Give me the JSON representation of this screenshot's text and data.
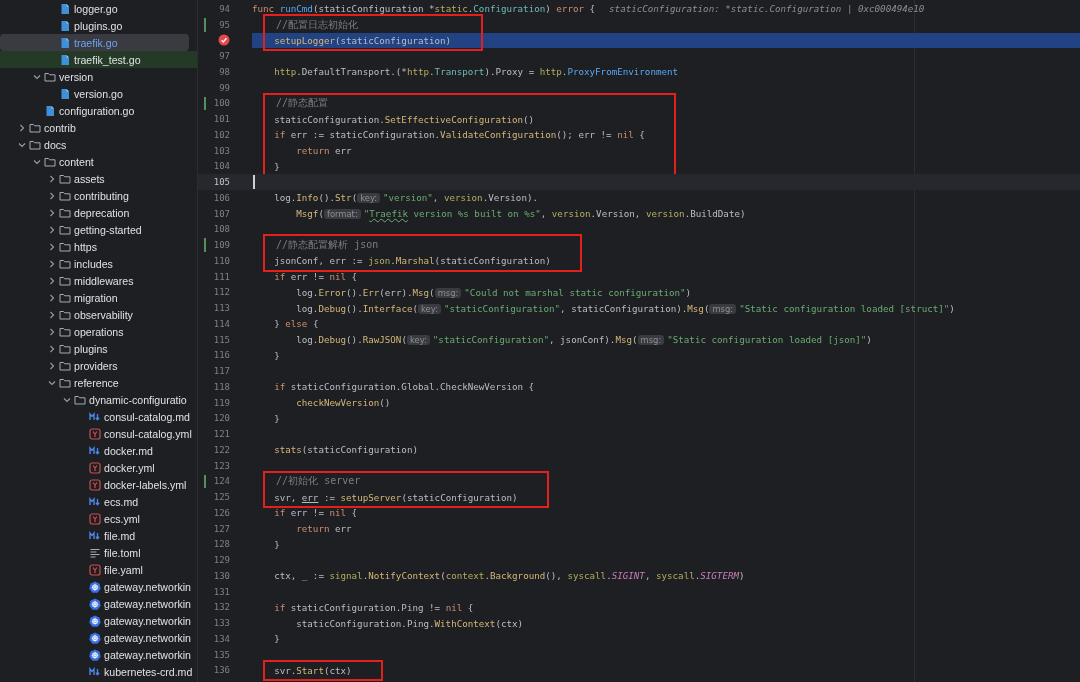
{
  "tree": [
    {
      "children": [
        {
          "children": [
            {
              "label": "logger.go",
              "kind": "go",
              "selected": false
            },
            {
              "label": "plugins.go",
              "kind": "go",
              "selected": false
            },
            {
              "label": "traefik.go",
              "kind": "go",
              "selected": true
            },
            {
              "label": "traefik_test.go",
              "kind": "go",
              "selected": false,
              "added": true
            }
          ]
        },
        {
          "label": "version",
          "kind": "folder",
          "expanded": true,
          "selected": false,
          "children": [
            {
              "label": "version.go",
              "kind": "go",
              "selected": false
            }
          ]
        },
        {
          "label": "configuration.go",
          "kind": "go",
          "selected": false
        }
      ]
    },
    {
      "label": "contrib",
      "kind": "folder",
      "expanded": false,
      "selected": false
    },
    {
      "label": "docs",
      "kind": "folder",
      "expanded": true,
      "selected": false,
      "children": [
        {
          "label": "content",
          "kind": "folder",
          "expanded": true,
          "selected": false,
          "children": [
            {
              "label": "assets",
              "kind": "folder",
              "expanded": false,
              "selected": false
            },
            {
              "label": "contributing",
              "kind": "folder",
              "expanded": false,
              "selected": false
            },
            {
              "label": "deprecation",
              "kind": "folder",
              "expanded": false,
              "selected": false
            },
            {
              "label": "getting-started",
              "kind": "folder",
              "expanded": false,
              "selected": false
            },
            {
              "label": "https",
              "kind": "folder",
              "expanded": false,
              "selected": false
            },
            {
              "label": "includes",
              "kind": "folder",
              "expanded": false,
              "selected": false
            },
            {
              "label": "middlewares",
              "kind": "folder",
              "expanded": false,
              "selected": false
            },
            {
              "label": "migration",
              "kind": "folder",
              "expanded": false,
              "selected": false
            },
            {
              "label": "observability",
              "kind": "folder",
              "expanded": false,
              "selected": false
            },
            {
              "label": "operations",
              "kind": "folder",
              "expanded": false,
              "selected": false
            },
            {
              "label": "plugins",
              "kind": "folder",
              "expanded": false,
              "selected": false
            },
            {
              "label": "providers",
              "kind": "folder",
              "expanded": false,
              "selected": false
            },
            {
              "label": "reference",
              "kind": "folder",
              "expanded": true,
              "selected": false,
              "children": [
                {
                  "label": "dynamic-configuratio",
                  "kind": "folder",
                  "expanded": true,
                  "selected": false,
                  "children": [
                    {
                      "label": "consul-catalog.md",
                      "kind": "md",
                      "selected": false
                    },
                    {
                      "label": "consul-catalog.yml",
                      "kind": "yml",
                      "selected": false
                    },
                    {
                      "label": "docker.md",
                      "kind": "md",
                      "selected": false
                    },
                    {
                      "label": "docker.yml",
                      "kind": "yml",
                      "selected": false
                    },
                    {
                      "label": "docker-labels.yml",
                      "kind": "yml",
                      "selected": false
                    },
                    {
                      "label": "ecs.md",
                      "kind": "md",
                      "selected": false
                    },
                    {
                      "label": "ecs.yml",
                      "kind": "yml",
                      "selected": false
                    },
                    {
                      "label": "file.md",
                      "kind": "md",
                      "selected": false
                    },
                    {
                      "label": "file.toml",
                      "kind": "toml",
                      "selected": false
                    },
                    {
                      "label": "file.yaml",
                      "kind": "yml",
                      "selected": false
                    },
                    {
                      "label": "gateway.networkin",
                      "kind": "k8s",
                      "selected": false
                    },
                    {
                      "label": "gateway.networkin",
                      "kind": "k8s",
                      "selected": false
                    },
                    {
                      "label": "gateway.networkin",
                      "kind": "k8s",
                      "selected": false
                    },
                    {
                      "label": "gateway.networkin",
                      "kind": "k8s",
                      "selected": false
                    },
                    {
                      "label": "gateway.networkin",
                      "kind": "k8s",
                      "selected": false
                    },
                    {
                      "label": "kubernetes-crd.md",
                      "kind": "md",
                      "selected": false
                    }
                  ]
                }
              ]
            }
          ]
        }
      ]
    }
  ],
  "code": {
    "blocks": [
      {
        "annotated": false,
        "lines": [
          {
            "number": "94",
            "tokens": [
              {
                "kind": "kw",
                "text": "func "
              },
              {
                "kind": "fn",
                "text": "runCmd"
              },
              {
                "kind": "plain",
                "text": "(staticConfiguration *"
              },
              {
                "kind": "pkg",
                "text": "static"
              },
              {
                "kind": "plain",
                "text": "."
              },
              {
                "kind": "type",
                "text": "Configuration"
              },
              {
                "kind": "plain",
                "text": ") "
              },
              {
                "kind": "kw",
                "text": "error"
              },
              {
                "kind": "plain",
                "text": " {"
              }
            ],
            "inline_value": "staticConfiguration: *static.Configuration | 0xc000494e10"
          }
        ]
      },
      {
        "annotated": true,
        "lines": [
          {
            "number": "95",
            "modified": true,
            "tokens": [
              {
                "kind": "comment",
                "text": "    //配置日志初始化"
              }
            ]
          },
          {
            "breakpoint": true,
            "execution": true,
            "tokens": [
              {
                "kind": "call",
                "text": "    setupLogger"
              },
              {
                "kind": "plain",
                "text": "(staticConfiguration)"
              }
            ]
          }
        ]
      },
      {
        "annotated": false,
        "lines": [
          {
            "number": "97"
          },
          {
            "number": "98",
            "tokens": [
              {
                "kind": "pkg",
                "text": "    http"
              },
              {
                "kind": "plain",
                "text": ".DefaultTransport.(*"
              },
              {
                "kind": "pkg",
                "text": "http"
              },
              {
                "kind": "plain",
                "text": "."
              },
              {
                "kind": "type",
                "text": "Transport"
              },
              {
                "kind": "plain",
                "text": ").Proxy = "
              },
              {
                "kind": "pkg",
                "text": "http"
              },
              {
                "kind": "plain",
                "text": "."
              },
              {
                "kind": "ref",
                "text": "ProxyFromEnvironment"
              }
            ]
          },
          {
            "number": "99"
          }
        ]
      },
      {
        "annotated": true,
        "lines": [
          {
            "number": "100",
            "modified": true,
            "tokens": [
              {
                "kind": "comment",
                "text": "    //静态配置"
              }
            ]
          },
          {
            "number": "101",
            "tokens": [
              {
                "kind": "plain",
                "text": "    staticConfiguration."
              },
              {
                "kind": "call",
                "text": "SetEffectiveConfiguration"
              },
              {
                "kind": "plain",
                "text": "()"
              }
            ]
          },
          {
            "number": "102",
            "tokens": [
              {
                "kind": "kw",
                "text": "    if "
              },
              {
                "kind": "plain",
                "text": "err := staticConfiguration."
              },
              {
                "kind": "call",
                "text": "ValidateConfiguration"
              },
              {
                "kind": "plain",
                "text": "(); err != "
              },
              {
                "kind": "kw",
                "text": "nil"
              },
              {
                "kind": "plain",
                "text": " {"
              }
            ]
          },
          {
            "number": "103",
            "tokens": [
              {
                "kind": "kw",
                "text": "        return "
              },
              {
                "kind": "plain",
                "text": "err"
              }
            ]
          },
          {
            "number": "104",
            "tokens": [
              {
                "kind": "plain",
                "text": "    }"
              }
            ]
          }
        ]
      },
      {
        "annotated": false,
        "lines": [
          {
            "number": "105",
            "caret": true
          },
          {
            "number": "106",
            "tokens": [
              {
                "kind": "plain",
                "text": "    log."
              },
              {
                "kind": "call",
                "text": "Info"
              },
              {
                "kind": "plain",
                "text": "()."
              },
              {
                "kind": "call",
                "text": "Str"
              },
              {
                "kind": "plain",
                "text": "("
              },
              {
                "kind": "hint",
                "text": "key:"
              },
              {
                "kind": "str",
                "text": "\"version\""
              },
              {
                "kind": "plain",
                "text": ", "
              },
              {
                "kind": "pkg",
                "text": "version"
              },
              {
                "kind": "plain",
                "text": ".Version)."
              }
            ]
          },
          {
            "number": "107",
            "tokens": [
              {
                "kind": "call",
                "text": "        Msgf"
              },
              {
                "kind": "plain",
                "text": "("
              },
              {
                "kind": "hint",
                "text": "format:"
              },
              {
                "kind": "str",
                "text": "\""
              },
              {
                "kind": "typo",
                "text": "Traefik"
              },
              {
                "kind": "str",
                "text": " version %s built on %s\""
              },
              {
                "kind": "plain",
                "text": ", "
              },
              {
                "kind": "pkg",
                "text": "version"
              },
              {
                "kind": "plain",
                "text": ".Version, "
              },
              {
                "kind": "pkg",
                "text": "version"
              },
              {
                "kind": "plain",
                "text": ".BuildDate)"
              }
            ]
          },
          {
            "number": "108"
          }
        ]
      },
      {
        "annotated": true,
        "lines": [
          {
            "number": "109",
            "modified": true,
            "tokens": [
              {
                "kind": "comment",
                "text": "    //静态配置解析 json"
              }
            ]
          },
          {
            "number": "110",
            "tokens": [
              {
                "kind": "plain",
                "text": "    jsonConf, err := "
              },
              {
                "kind": "pkg",
                "text": "json"
              },
              {
                "kind": "plain",
                "text": "."
              },
              {
                "kind": "call",
                "text": "Marshal"
              },
              {
                "kind": "plain",
                "text": "(staticConfiguration)"
              }
            ]
          }
        ]
      },
      {
        "annotated": false,
        "lines": [
          {
            "number": "111",
            "tokens": [
              {
                "kind": "kw",
                "text": "    if "
              },
              {
                "kind": "plain",
                "text": "err != "
              },
              {
                "kind": "kw",
                "text": "nil"
              },
              {
                "kind": "plain",
                "text": " {"
              }
            ]
          },
          {
            "number": "112",
            "tokens": [
              {
                "kind": "plain",
                "text": "        log."
              },
              {
                "kind": "call",
                "text": "Error"
              },
              {
                "kind": "plain",
                "text": "()."
              },
              {
                "kind": "call",
                "text": "Err"
              },
              {
                "kind": "plain",
                "text": "(err)."
              },
              {
                "kind": "call",
                "text": "Msg"
              },
              {
                "kind": "plain",
                "text": "("
              },
              {
                "kind": "hint",
                "text": "msg:"
              },
              {
                "kind": "str",
                "text": "\"Could not marshal static configuration\""
              },
              {
                "kind": "plain",
                "text": ")"
              }
            ]
          },
          {
            "number": "113",
            "tokens": [
              {
                "kind": "plain",
                "text": "        log."
              },
              {
                "kind": "call",
                "text": "Debug"
              },
              {
                "kind": "plain",
                "text": "()."
              },
              {
                "kind": "call",
                "text": "Interface"
              },
              {
                "kind": "plain",
                "text": "("
              },
              {
                "kind": "hint",
                "text": "key:"
              },
              {
                "kind": "str",
                "text": "\"staticConfiguration\""
              },
              {
                "kind": "plain",
                "text": ", staticConfiguration)."
              },
              {
                "kind": "call",
                "text": "Msg"
              },
              {
                "kind": "plain",
                "text": "("
              },
              {
                "kind": "hint",
                "text": "msg:"
              },
              {
                "kind": "str",
                "text": "\"Static configuration loaded [struct]\""
              },
              {
                "kind": "plain",
                "text": ")"
              }
            ]
          },
          {
            "number": "114",
            "tokens": [
              {
                "kind": "plain",
                "text": "    } "
              },
              {
                "kind": "kw",
                "text": "else"
              },
              {
                "kind": "plain",
                "text": " {"
              }
            ]
          },
          {
            "number": "115",
            "tokens": [
              {
                "kind": "plain",
                "text": "        log."
              },
              {
                "kind": "call",
                "text": "Debug"
              },
              {
                "kind": "plain",
                "text": "()."
              },
              {
                "kind": "call",
                "text": "RawJSON"
              },
              {
                "kind": "plain",
                "text": "("
              },
              {
                "kind": "hint",
                "text": "key:"
              },
              {
                "kind": "str",
                "text": "\"staticConfiguration\""
              },
              {
                "kind": "plain",
                "text": ", jsonConf)."
              },
              {
                "kind": "call",
                "text": "Msg"
              },
              {
                "kind": "plain",
                "text": "("
              },
              {
                "kind": "hint",
                "text": "msg:"
              },
              {
                "kind": "str",
                "text": "\"Static configuration loaded [json]\""
              },
              {
                "kind": "plain",
                "text": ")"
              }
            ]
          },
          {
            "number": "116",
            "tokens": [
              {
                "kind": "plain",
                "text": "    }"
              }
            ]
          },
          {
            "number": "117"
          },
          {
            "number": "118",
            "tokens": [
              {
                "kind": "kw",
                "text": "    if "
              },
              {
                "kind": "plain",
                "text": "staticConfiguration.Global.CheckNewVersion {"
              }
            ]
          },
          {
            "number": "119",
            "tokens": [
              {
                "kind": "call",
                "text": "        checkNewVersion"
              },
              {
                "kind": "plain",
                "text": "()"
              }
            ]
          },
          {
            "number": "120",
            "tokens": [
              {
                "kind": "plain",
                "text": "    }"
              }
            ]
          },
          {
            "number": "121"
          },
          {
            "number": "122",
            "tokens": [
              {
                "kind": "call",
                "text": "    stats"
              },
              {
                "kind": "plain",
                "text": "(staticConfiguration)"
              }
            ]
          },
          {
            "number": "123"
          }
        ]
      },
      {
        "annotated": true,
        "lines": [
          {
            "number": "124",
            "modified": true,
            "tokens": [
              {
                "kind": "comment",
                "text": "    //初始化 server"
              }
            ]
          },
          {
            "number": "125",
            "tokens": [
              {
                "kind": "plain",
                "text": "    svr, "
              },
              {
                "kind": "under",
                "text": "err"
              },
              {
                "kind": "plain",
                "text": " := "
              },
              {
                "kind": "call",
                "text": "setupServer"
              },
              {
                "kind": "plain",
                "text": "(staticConfiguration)"
              }
            ]
          }
        ]
      },
      {
        "annotated": false,
        "lines": [
          {
            "number": "126",
            "tokens": [
              {
                "kind": "kw",
                "text": "    if "
              },
              {
                "kind": "plain",
                "text": "err != "
              },
              {
                "kind": "kw",
                "text": "nil"
              },
              {
                "kind": "plain",
                "text": " {"
              }
            ]
          },
          {
            "number": "127",
            "tokens": [
              {
                "kind": "kw",
                "text": "        return "
              },
              {
                "kind": "plain",
                "text": "err"
              }
            ]
          },
          {
            "number": "128",
            "tokens": [
              {
                "kind": "plain",
                "text": "    }"
              }
            ]
          },
          {
            "number": "129"
          },
          {
            "number": "130",
            "tokens": [
              {
                "kind": "plain",
                "text": "    ctx, _ := "
              },
              {
                "kind": "pkg",
                "text": "signal"
              },
              {
                "kind": "plain",
                "text": "."
              },
              {
                "kind": "call",
                "text": "NotifyContext"
              },
              {
                "kind": "plain",
                "text": "("
              },
              {
                "kind": "pkg",
                "text": "context"
              },
              {
                "kind": "plain",
                "text": "."
              },
              {
                "kind": "call",
                "text": "Background"
              },
              {
                "kind": "plain",
                "text": "(), "
              },
              {
                "kind": "pkg",
                "text": "syscall"
              },
              {
                "kind": "plain",
                "text": "."
              },
              {
                "kind": "const",
                "text": "SIGINT"
              },
              {
                "kind": "plain",
                "text": ", "
              },
              {
                "kind": "pkg",
                "text": "syscall"
              },
              {
                "kind": "plain",
                "text": "."
              },
              {
                "kind": "const",
                "text": "SIGTERM"
              },
              {
                "kind": "plain",
                "text": ")"
              }
            ]
          },
          {
            "number": "131"
          },
          {
            "number": "132",
            "tokens": [
              {
                "kind": "kw",
                "text": "    if "
              },
              {
                "kind": "plain",
                "text": "staticConfiguration.Ping != "
              },
              {
                "kind": "kw",
                "text": "nil"
              },
              {
                "kind": "plain",
                "text": " {"
              }
            ]
          },
          {
            "number": "133",
            "tokens": [
              {
                "kind": "plain",
                "text": "        staticConfiguration.Ping."
              },
              {
                "kind": "call",
                "text": "WithContext"
              },
              {
                "kind": "plain",
                "text": "(ctx)"
              }
            ]
          },
          {
            "number": "134",
            "tokens": [
              {
                "kind": "plain",
                "text": "    }"
              }
            ]
          },
          {
            "number": "135"
          }
        ]
      },
      {
        "annotated": true,
        "lines": [
          {
            "number": "136",
            "tokens": [
              {
                "kind": "plain",
                "text": "    svr."
              },
              {
                "kind": "call",
                "text": "Start"
              },
              {
                "kind": "plain",
                "text": "(ctx)"
              }
            ]
          }
        ]
      }
    ]
  }
}
